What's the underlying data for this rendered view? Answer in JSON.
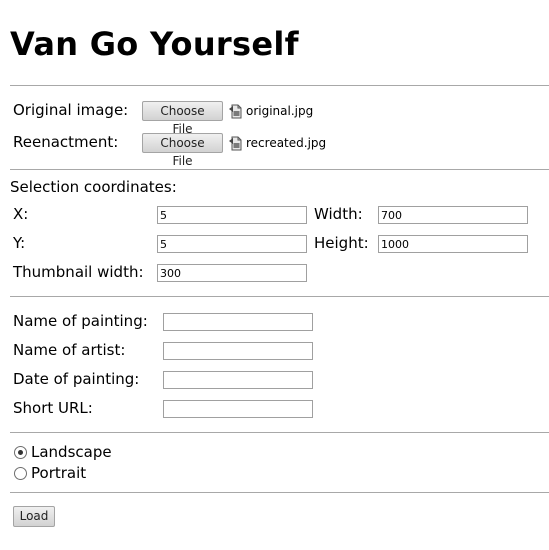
{
  "page": {
    "title": "Van Go Yourself"
  },
  "images": {
    "original": {
      "label": "Original image:",
      "button": "Choose File",
      "filename": "original.jpg",
      "icon": "file-image-icon"
    },
    "reenactment": {
      "label": "Reenactment:",
      "button": "Choose File",
      "filename": "recreated.jpg",
      "icon": "file-image-icon"
    }
  },
  "selection": {
    "heading": "Selection coordinates:",
    "x": {
      "label": "X:",
      "value": "5"
    },
    "y": {
      "label": "Y:",
      "value": "5"
    },
    "width": {
      "label": "Width:",
      "value": "700"
    },
    "height": {
      "label": "Height:",
      "value": "1000"
    },
    "thumbnail": {
      "label": "Thumbnail width:",
      "value": "300"
    }
  },
  "details": {
    "painting": {
      "label": "Name of painting:",
      "value": ""
    },
    "artist": {
      "label": "Name of artist:",
      "value": ""
    },
    "date": {
      "label": "Date of painting:",
      "value": ""
    },
    "url": {
      "label": "Short URL:",
      "value": ""
    }
  },
  "orientation": {
    "landscape": {
      "label": "Landscape",
      "checked": true
    },
    "portrait": {
      "label": "Portrait",
      "checked": false
    }
  },
  "actions": {
    "load_label": "Load"
  }
}
